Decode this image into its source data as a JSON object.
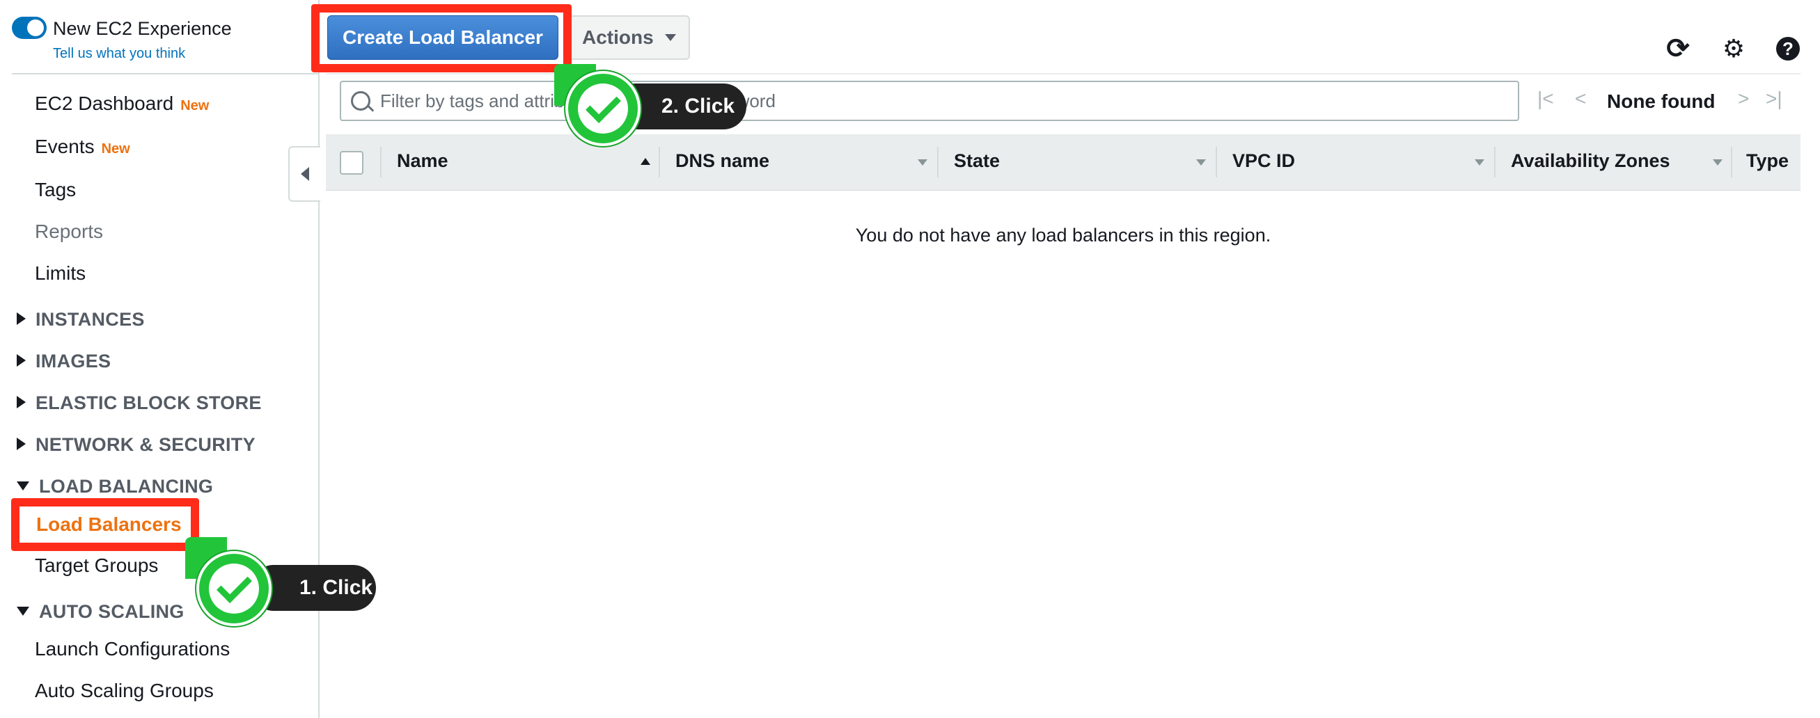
{
  "experience": {
    "toggle_on": true,
    "title": "New EC2 Experience",
    "feedback_link": "Tell us what you think"
  },
  "sidebar": {
    "top_items": [
      {
        "label": "EC2 Dashboard",
        "badge": "New"
      },
      {
        "label": "Events",
        "badge": "New"
      },
      {
        "label": "Tags",
        "badge": ""
      },
      {
        "label": "Reports",
        "badge": ""
      },
      {
        "label": "Limits",
        "badge": ""
      }
    ],
    "sections": {
      "instances": "INSTANCES",
      "images": "IMAGES",
      "ebs": "ELASTIC BLOCK STORE",
      "network": "NETWORK & SECURITY",
      "load_balancing": "LOAD BALANCING",
      "auto_scaling": "AUTO SCALING"
    },
    "load_balancing_items": [
      "Load Balancers",
      "Target Groups"
    ],
    "auto_scaling_items": [
      "Launch Configurations",
      "Auto Scaling Groups"
    ]
  },
  "toolbar": {
    "create_label": "Create Load Balancer",
    "actions_label": "Actions"
  },
  "filter": {
    "placeholder": "Filter by tags and attributes or search by keyword"
  },
  "pagination": {
    "status": "None found"
  },
  "table": {
    "columns": [
      "Name",
      "DNS name",
      "State",
      "VPC ID",
      "Availability Zones",
      "Type"
    ],
    "sorted_column": "Name",
    "empty_message": "You do not have any load balancers in this region."
  },
  "tutorial": {
    "step1": "1. Click",
    "step2": "2. Click",
    "highlight_color": "#ff2c1a",
    "pin_color": "#22c53a"
  },
  "colors": {
    "accent_orange": "#ec7211",
    "primary_blue": "#2f6fc0",
    "link_blue": "#0073bb"
  }
}
